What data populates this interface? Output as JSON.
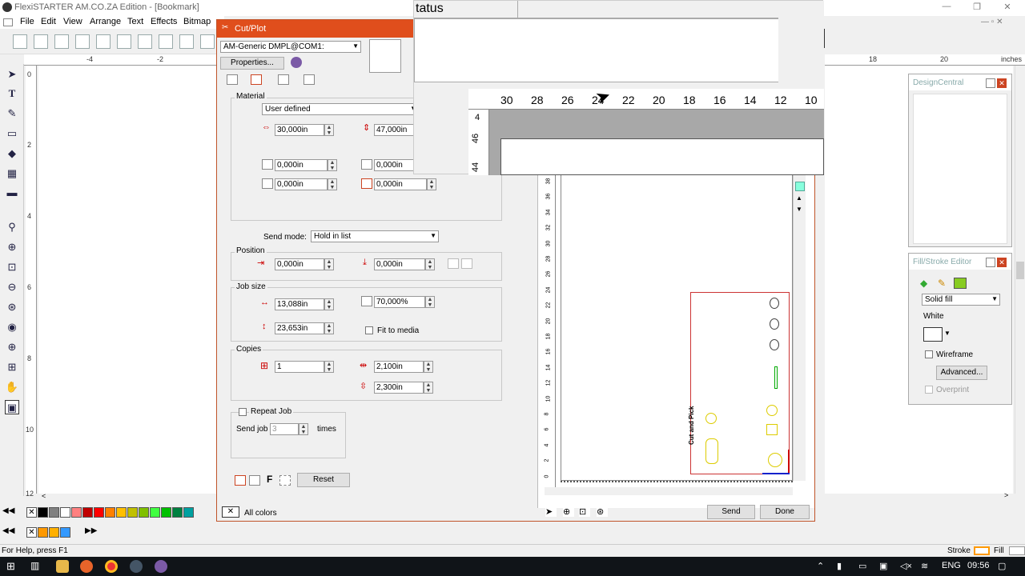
{
  "app": {
    "title": "FlexiSTARTER AM.CO.ZA Edition - [Bookmark]",
    "menu": [
      "File",
      "Edit",
      "View",
      "Arrange",
      "Text",
      "Effects",
      "Bitmap"
    ]
  },
  "rulers": {
    "top_left": [
      "-4",
      "-2"
    ],
    "top_right": [
      "18",
      "20",
      "inches"
    ],
    "left": [
      "0",
      "2",
      "4",
      "6",
      "8",
      "10",
      "12"
    ]
  },
  "dialog": {
    "title": "Cut/Plot",
    "device": "AM-Generic DMPL@COM1:",
    "properties_label": "Properties...",
    "material": {
      "label": "Material",
      "preset": "User defined",
      "width": "30,000in",
      "height": "47,000in",
      "margin_tl": "0,000in",
      "margin_tr": "0,000in",
      "margin_bl": "0,000in",
      "margin_br": "0,000in"
    },
    "send_mode": {
      "label": "Send mode:",
      "value": "Hold in list"
    },
    "position": {
      "label": "Position",
      "x": "0,000in",
      "y": "0,000in"
    },
    "job_size": {
      "label": "Job size",
      "width": "13,088in",
      "height": "23,653in",
      "scale": "70,000%",
      "fit_label": "Fit to media"
    },
    "copies": {
      "label": "Copies",
      "count": "1",
      "spacing_x": "2,100in",
      "spacing_y": "2,300in"
    },
    "repeat": {
      "label": "Repeat Job",
      "send_job_label": "Send job",
      "times_value": "3",
      "times_label": "times"
    },
    "reset_label": "Reset",
    "all_colors": "All colors",
    "send_label": "Send",
    "done_label": "Done"
  },
  "status_window": {
    "header": "tatus",
    "ruler": [
      "30",
      "28",
      "26",
      "24",
      "22",
      "20",
      "18",
      "16",
      "14",
      "12",
      "10"
    ],
    "vruler": [
      "4",
      "46",
      "44"
    ]
  },
  "preview": {
    "vruler": [
      "38",
      "36",
      "34",
      "32",
      "30",
      "28",
      "26",
      "24",
      "22",
      "20",
      "18",
      "16",
      "14",
      "12",
      "10",
      "8",
      "6",
      "4",
      "2",
      "0"
    ],
    "job_text": "Cut and Pick"
  },
  "panels": {
    "design_central": "DesignCentral",
    "fill_stroke": {
      "title": "Fill/Stroke Editor",
      "fill_type": "Solid fill",
      "color_name": "White",
      "wireframe": "Wireframe",
      "advanced": "Advanced...",
      "overprint": "Overprint"
    }
  },
  "statusbar": {
    "help": "For Help, press F1",
    "stroke": "Stroke",
    "fill": "Fill"
  },
  "taskbar": {
    "lang": "ENG",
    "time": "09:56"
  },
  "colors": {
    "palette_row1": [
      "#000000",
      "#808080",
      "#ffffff",
      "#ff8080",
      "#c00000",
      "#ff0000",
      "#ff8000",
      "#ffbf00",
      "#c0c000",
      "#80c000",
      "#40ff40",
      "#00c000",
      "#008040",
      "#00a0a0"
    ],
    "palette_row2": [
      "#ff9900",
      "#ffb000",
      "#3399ff"
    ],
    "dialog_title": "#e04e1c"
  }
}
